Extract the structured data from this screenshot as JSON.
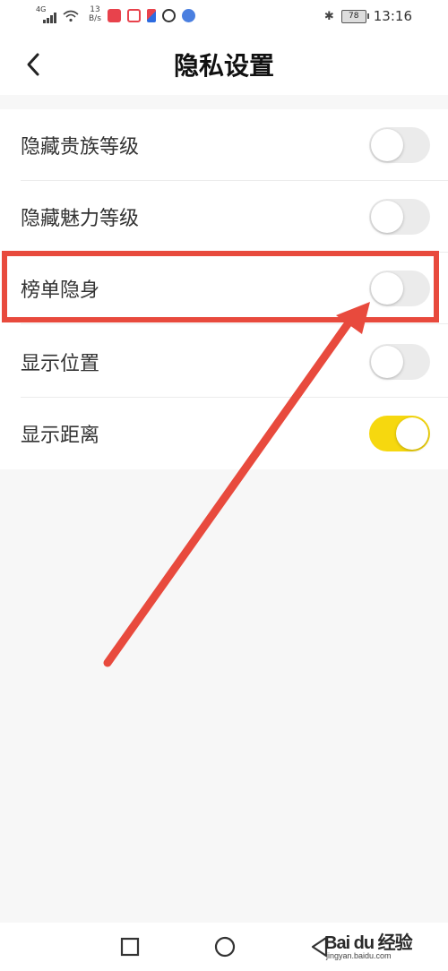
{
  "status_bar": {
    "network_type": "4G",
    "net_speed_value": "13",
    "net_speed_unit": "B/s",
    "battery_level": "78",
    "time": "13:16"
  },
  "header": {
    "title": "隐私设置",
    "back_icon": "chevron-left-icon"
  },
  "settings": [
    {
      "label": "隐藏贵族等级",
      "enabled": false
    },
    {
      "label": "隐藏魅力等级",
      "enabled": false
    },
    {
      "label": "榜单隐身",
      "enabled": false,
      "highlighted": true
    },
    {
      "label": "显示位置",
      "enabled": false
    },
    {
      "label": "显示距离",
      "enabled": true
    }
  ],
  "colors": {
    "toggle_on": "#f6d80f",
    "toggle_off": "#ebebeb",
    "annotation": "#e84a3d"
  },
  "nav_bar": {
    "icons": [
      "recents-icon",
      "home-icon",
      "back-triangle-icon"
    ]
  },
  "watermark": {
    "logo": "Bai du 经验",
    "url": "jingyan.baidu.com"
  }
}
